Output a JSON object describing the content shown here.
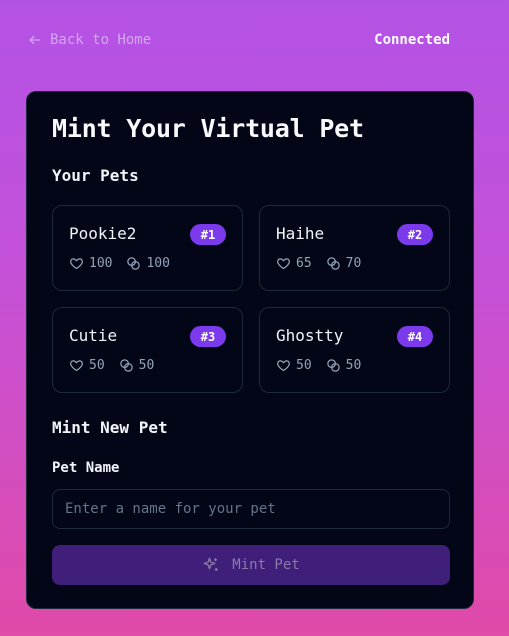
{
  "header": {
    "back_label": "Back to Home",
    "status": "Connected"
  },
  "card": {
    "title": "Mint Your Virtual Pet",
    "pets_section_title": "Your Pets",
    "pets": [
      {
        "name": "Pookie2",
        "badge": "#1",
        "health": "100",
        "energy": "100"
      },
      {
        "name": "Haihe",
        "badge": "#2",
        "health": "65",
        "energy": "70"
      },
      {
        "name": "Cutie",
        "badge": "#3",
        "health": "50",
        "energy": "50"
      },
      {
        "name": "Ghostty",
        "badge": "#4",
        "health": "50",
        "energy": "50"
      }
    ],
    "mint_section_title": "Mint New Pet",
    "pet_name_label": "Pet Name",
    "pet_name_placeholder": "Enter a name for your pet",
    "pet_name_value": "",
    "mint_button_label": "Mint Pet"
  },
  "icons": {
    "back": "arrow-left-icon",
    "health": "heart-icon",
    "energy": "coins-icon",
    "mint": "sparkles-icon"
  },
  "colors": {
    "accent": "#7c3aed",
    "card_bg": "#020617",
    "button_disabled": "#3f1f7a"
  }
}
